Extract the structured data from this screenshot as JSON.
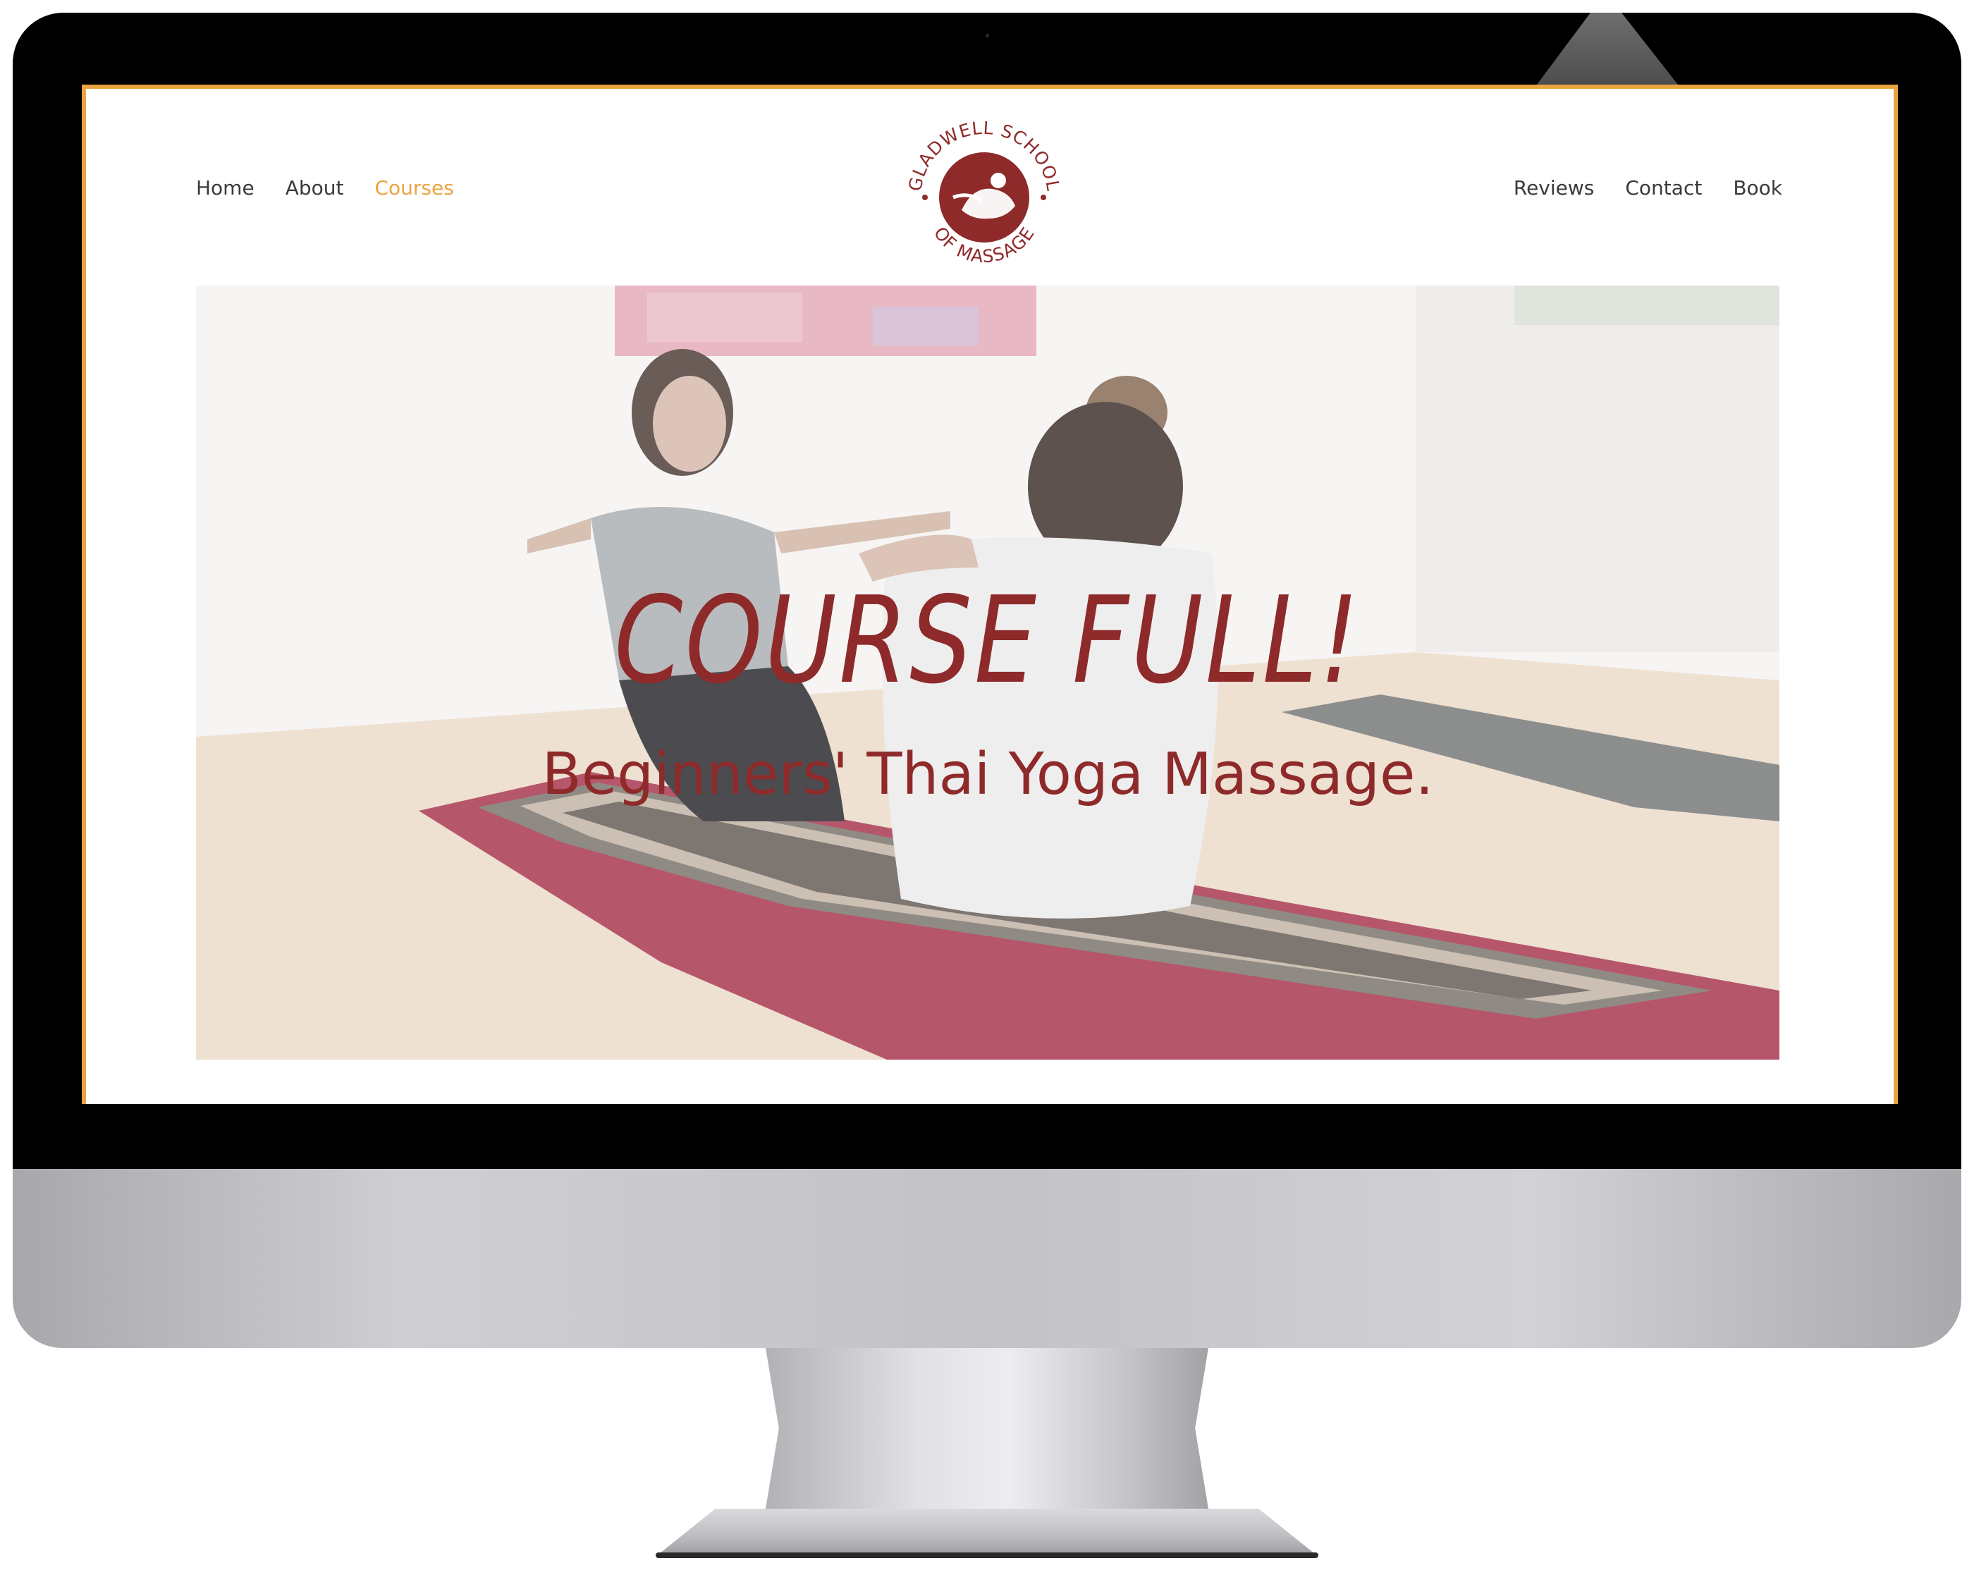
{
  "nav": {
    "left": [
      {
        "label": "Home",
        "active": false
      },
      {
        "label": "About",
        "active": false
      },
      {
        "label": "Courses",
        "active": true
      }
    ],
    "right": [
      {
        "label": "Reviews",
        "active": false
      },
      {
        "label": "Contact",
        "active": false
      },
      {
        "label": "Book",
        "active": false
      }
    ]
  },
  "logo": {
    "text_top": "GLADWELL SCHOOL",
    "text_bottom": "OF MASSAGE"
  },
  "hero": {
    "title": "COURSE FULL!",
    "subtitle": "Beginners' Thai Yoga Massage."
  },
  "colors": {
    "accent": "#e9a43e",
    "brand": "#8e2a2a"
  }
}
